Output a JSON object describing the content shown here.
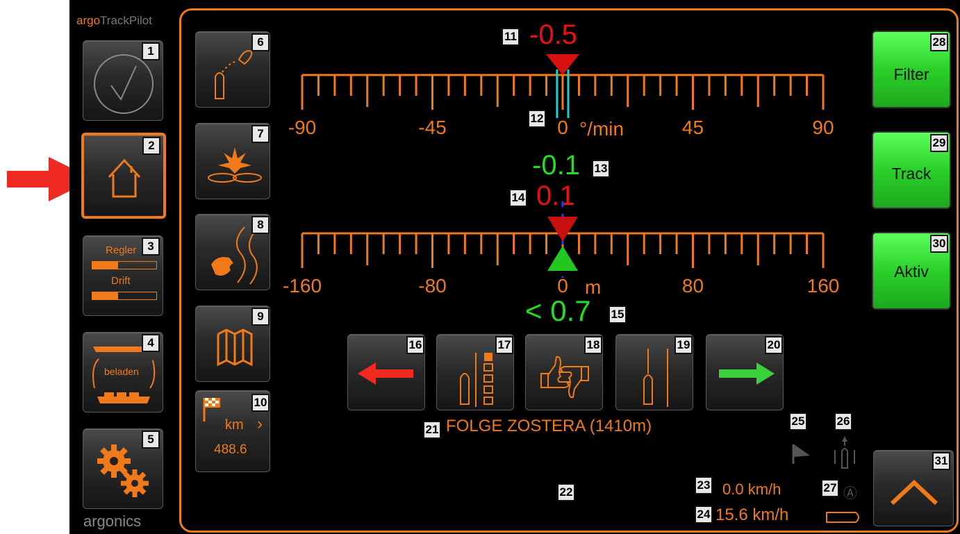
{
  "brand": {
    "top_prefix": "argo",
    "top_suffix": "TrackPilot",
    "bottom": "argonics"
  },
  "left_buttons": [
    {
      "badge": "1"
    },
    {
      "badge": "2"
    },
    {
      "badge": "3",
      "regler": "Regler",
      "drift": "Drift",
      "regler_level": 0.4,
      "drift_level": 0.4
    },
    {
      "badge": "4",
      "label": "beladen"
    },
    {
      "badge": "5"
    }
  ],
  "mid_buttons": [
    {
      "badge": "6"
    },
    {
      "badge": "7"
    },
    {
      "badge": "8"
    },
    {
      "badge": "9"
    },
    {
      "badge": "10",
      "unit": "km",
      "value": "488.6"
    }
  ],
  "turn_scale": {
    "badge_value": "11",
    "value": "-0.5",
    "badge_zero": "12",
    "ticks": [
      "-90",
      "-45",
      "0",
      "45",
      "90"
    ],
    "unit": "°/min",
    "marker_value": -0.5
  },
  "turn_readout": {
    "value": "-0.1",
    "badge": "13"
  },
  "offset_scale": {
    "badge_value": "14",
    "value": "0.1",
    "ticks": [
      "-160",
      "-80",
      "0",
      "80",
      "160"
    ],
    "unit": "m"
  },
  "deviation": {
    "value": "< 0.7",
    "badge": "15"
  },
  "action_buttons": [
    {
      "badge": "16"
    },
    {
      "badge": "17"
    },
    {
      "badge": "18"
    },
    {
      "badge": "19"
    },
    {
      "badge": "20"
    }
  ],
  "status": {
    "badge": "21",
    "text": "FOLGE ZOSTERA (1410m)"
  },
  "badges_misc": {
    "b22": "22",
    "b23": "23",
    "b24": "24",
    "b25": "25",
    "b26": "26",
    "b27": "27"
  },
  "speed1": "0.0 km/h",
  "speed2": "15.6 km/h",
  "right_buttons": [
    {
      "badge": "28",
      "label": "Filter"
    },
    {
      "badge": "29",
      "label": "Track"
    },
    {
      "badge": "30",
      "label": "Aktiv"
    }
  ],
  "up_button": {
    "badge": "31"
  },
  "colors": {
    "accent": "#f07a1a",
    "green": "#2ad02a",
    "red": "#e81010",
    "readout_green": "#22dd22"
  }
}
